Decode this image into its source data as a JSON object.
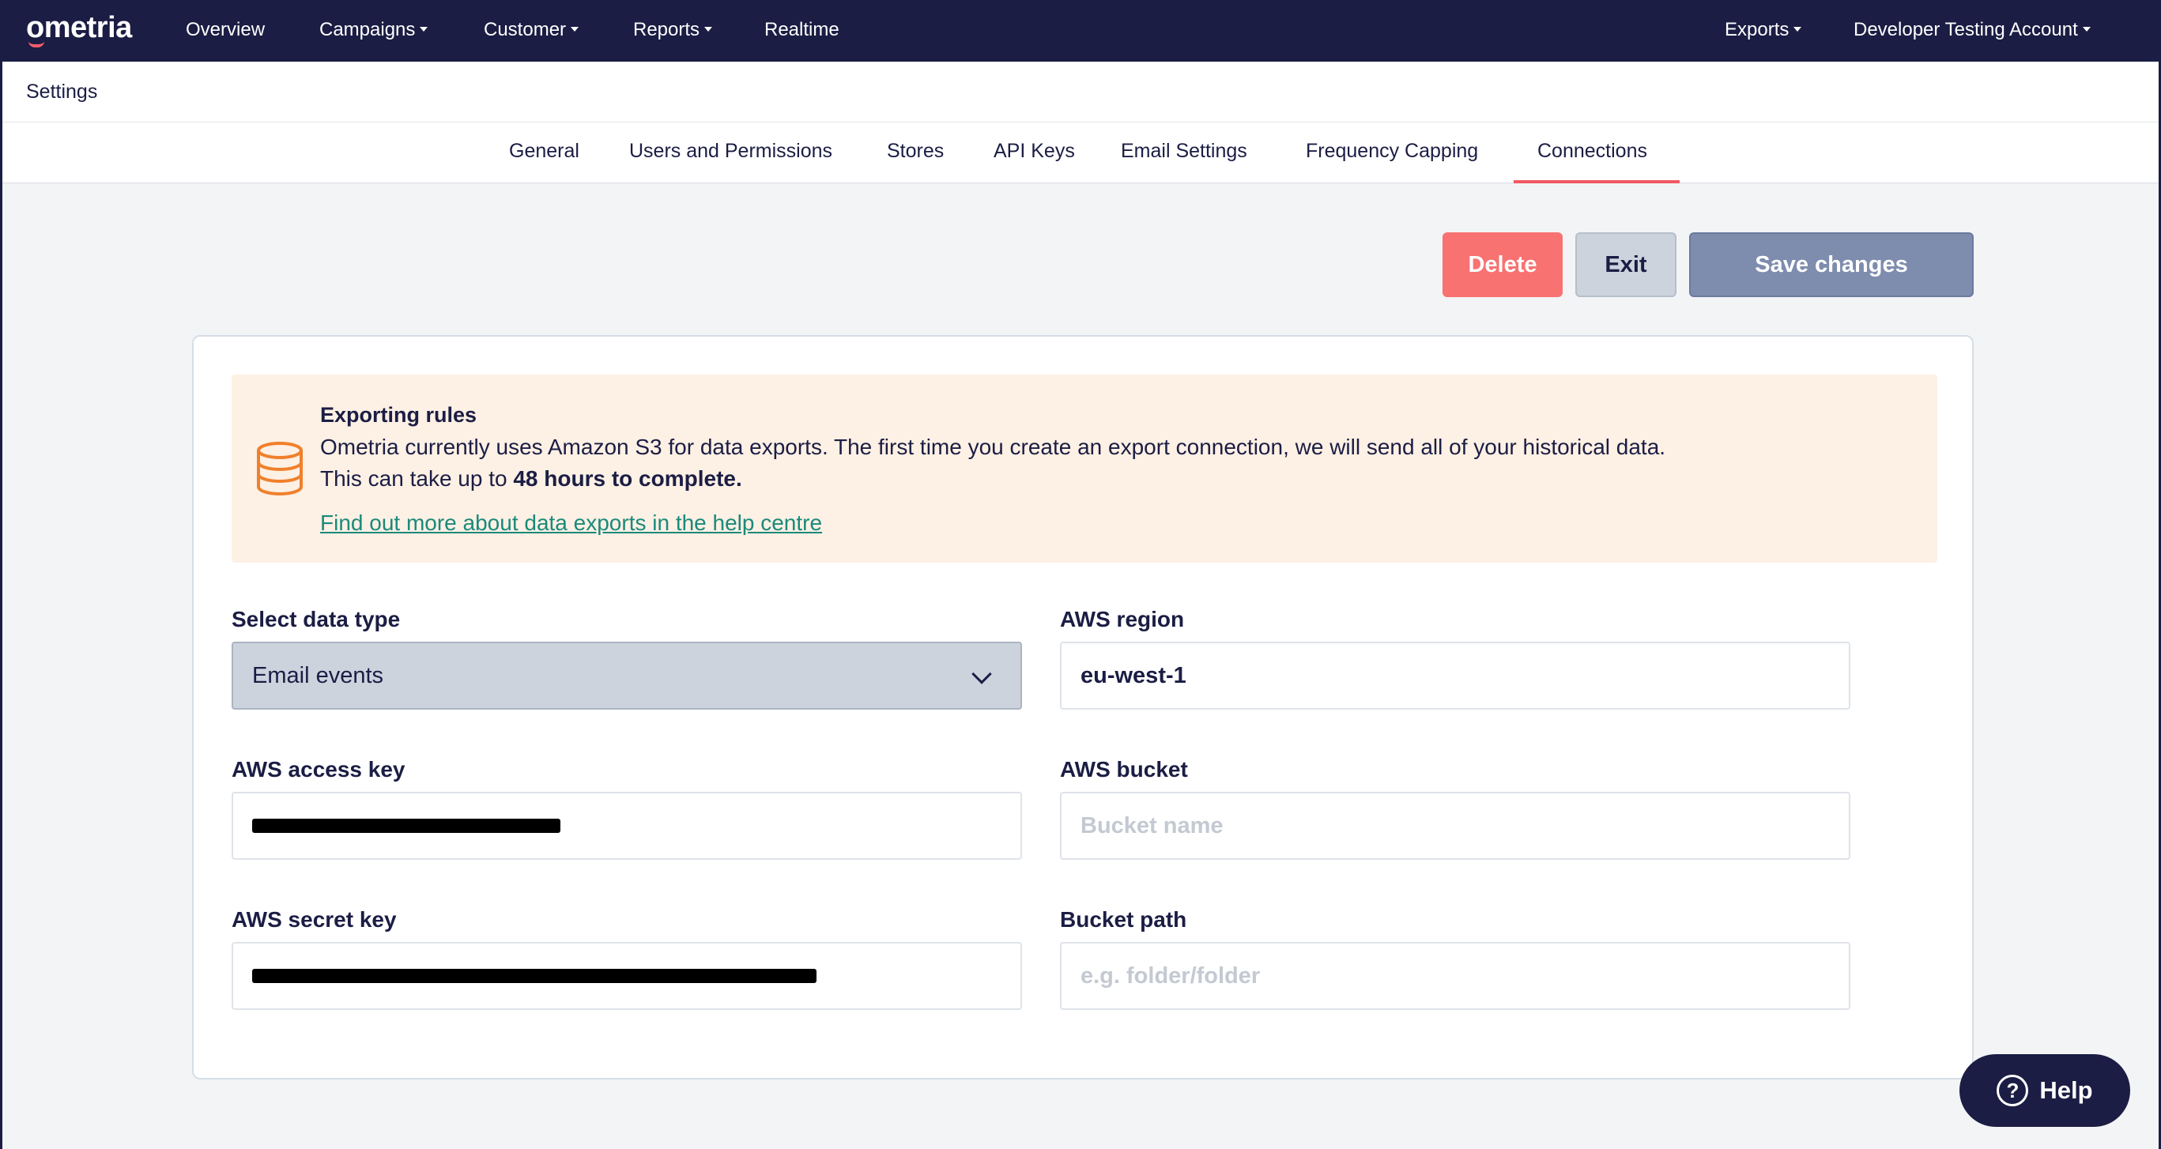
{
  "topnav": {
    "logo": "ometria",
    "items": [
      {
        "label": "Overview",
        "dropdown": false
      },
      {
        "label": "Campaigns",
        "dropdown": true
      },
      {
        "label": "Customer",
        "dropdown": true
      },
      {
        "label": "Reports",
        "dropdown": true
      },
      {
        "label": "Realtime",
        "dropdown": false
      }
    ],
    "right_items": [
      {
        "label": "Exports",
        "dropdown": true
      },
      {
        "label": "Developer Testing Account",
        "dropdown": true
      }
    ]
  },
  "settings": {
    "title": "Settings"
  },
  "tabs": [
    {
      "label": "General"
    },
    {
      "label": "Users and Permissions"
    },
    {
      "label": "Stores"
    },
    {
      "label": "API Keys"
    },
    {
      "label": "Email Settings"
    },
    {
      "label": "Frequency Capping"
    },
    {
      "label": "Connections",
      "active": true
    }
  ],
  "actions": {
    "delete": "Delete",
    "exit": "Exit",
    "save": "Save changes"
  },
  "notice": {
    "icon": "database-icon",
    "title": "Exporting rules",
    "line1": "Ometria currently uses Amazon S3 for data exports. The first time you create an export connection, we will send all of your historical data.",
    "line2_prefix": "This can take up to",
    "line2_bold": "48 hours to complete.",
    "link": "Find out more about data exports in the help centre"
  },
  "form": {
    "data_type": {
      "label": "Select data type",
      "value": "Email events"
    },
    "aws_region": {
      "label": "AWS region",
      "value": "eu-west-1"
    },
    "access_key": {
      "label": "AWS access key",
      "value": "[redacted]"
    },
    "bucket": {
      "label": "AWS bucket",
      "placeholder": "Bucket name"
    },
    "secret_key": {
      "label": "AWS secret key",
      "value": "[redacted]"
    },
    "bucket_path": {
      "label": "Bucket path",
      "placeholder": "e.g. folder/folder"
    }
  },
  "help": {
    "label": "Help",
    "icon": "question-icon"
  },
  "colors": {
    "nav_bg": "#1b1d44",
    "accent_red": "#ef5a63",
    "delete": "#f87272",
    "save": "#7e8cae",
    "notice_bg": "#fdf0e4",
    "notice_icon": "#f0802b",
    "link": "#1a8a7a"
  }
}
